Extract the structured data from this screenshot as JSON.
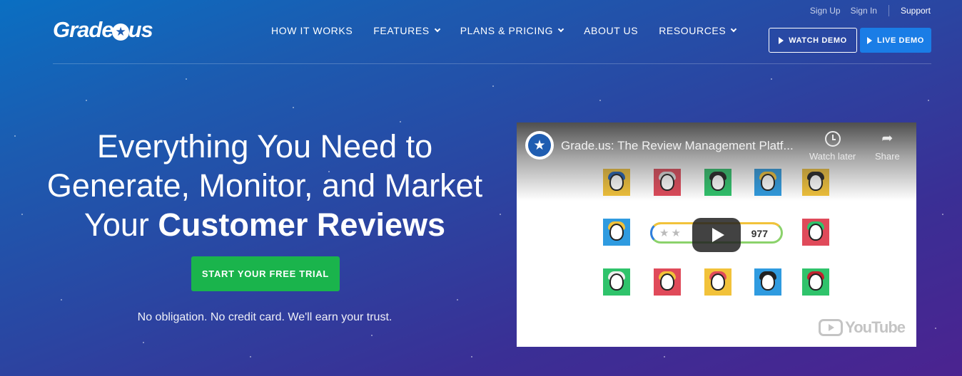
{
  "brand": {
    "logo_text_left": "Grade",
    "logo_text_right": "us"
  },
  "utility_nav": {
    "sign_up": "Sign Up",
    "sign_in": "Sign In",
    "support": "Support"
  },
  "nav": {
    "items": [
      {
        "label": "HOW IT WORKS",
        "has_dropdown": false
      },
      {
        "label": "FEATURES",
        "has_dropdown": true
      },
      {
        "label": "PLANS & PRICING",
        "has_dropdown": true
      },
      {
        "label": "ABOUT US",
        "has_dropdown": false
      },
      {
        "label": "RESOURCES",
        "has_dropdown": true
      }
    ]
  },
  "header_buttons": {
    "watch_demo": "WATCH DEMO",
    "live_demo": "LIVE DEMO"
  },
  "hero": {
    "line1": "Everything You Need to",
    "line2": "Generate, Monitor, and Market",
    "line3_prefix": "Your ",
    "line3_bold": "Customer Reviews",
    "cta": "START YOUR FREE TRIAL",
    "note": "No obligation. No credit card. We'll earn your trust."
  },
  "video": {
    "title": "Grade.us: The Review Management Platf...",
    "watch_later": "Watch later",
    "share": "Share",
    "review_count": "977",
    "youtube_label": "YouTube"
  },
  "colors": {
    "cta_green": "#1ab44c",
    "live_demo_blue": "#1a7de6",
    "bg_top": "#0a6fc2",
    "bg_bottom": "#4b2390"
  }
}
